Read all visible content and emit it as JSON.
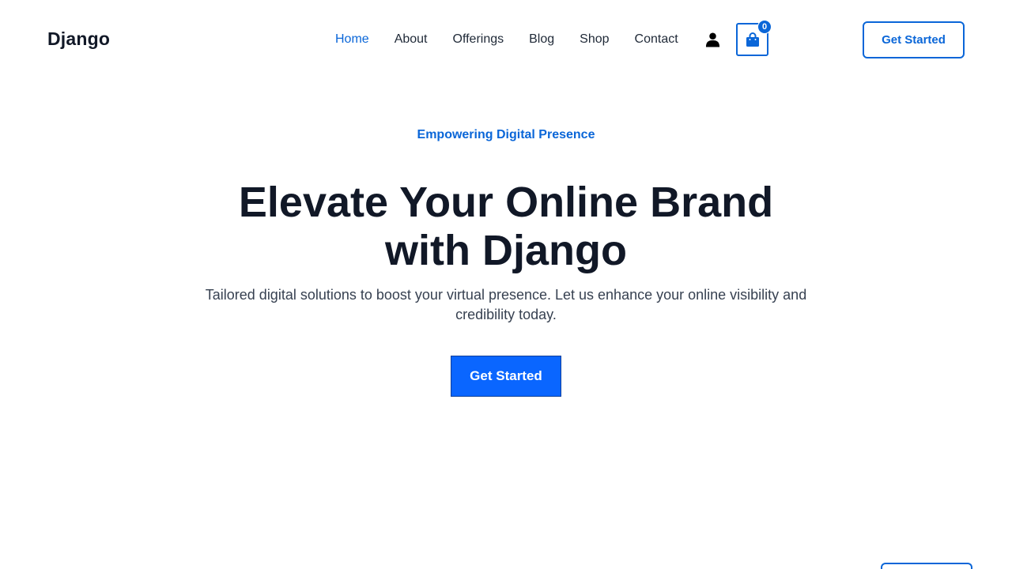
{
  "header": {
    "logo": "Django",
    "nav": [
      "Home",
      "About",
      "Offerings",
      "Blog",
      "Shop",
      "Contact"
    ],
    "active_nav": "Home",
    "cart_count": "0",
    "cta_label": "Get Started",
    "icons": {
      "account": "user-icon",
      "cart": "shopping-bag-icon"
    }
  },
  "hero": {
    "eyebrow": "Empowering Digital Presence",
    "title_line1": "Elevate Your Online Brand",
    "title_line2": "with Django",
    "subtitle": "Tailored digital solutions to boost your virtual presence. Let us enhance your online visibility and credibility today.",
    "cta_label": "Get Started"
  },
  "colors": {
    "accent": "#0a66d8",
    "primary_button": "#0a66ff",
    "heading": "#111827",
    "body_text": "#374151"
  }
}
